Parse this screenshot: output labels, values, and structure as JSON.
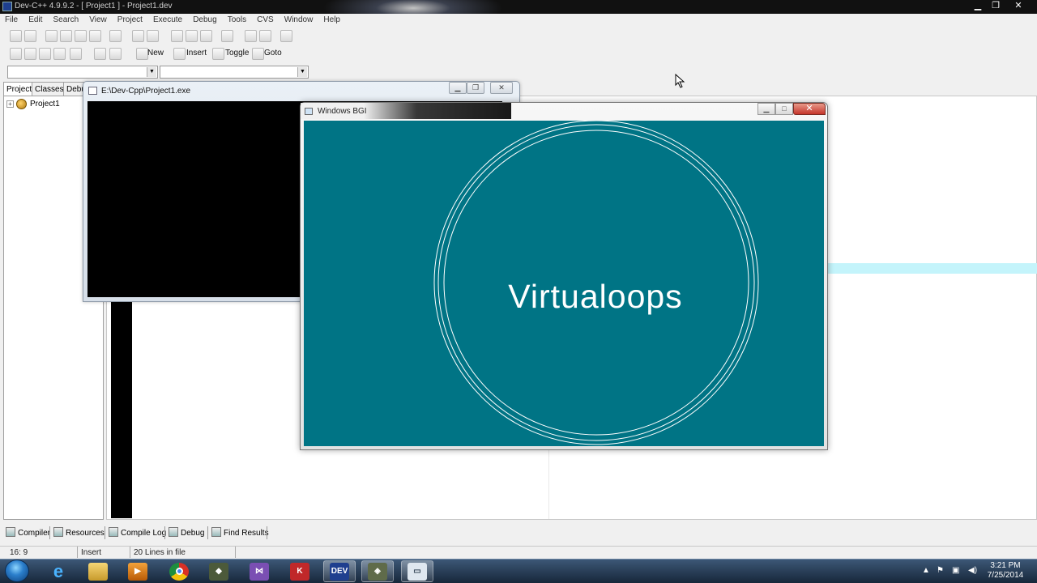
{
  "devcpp": {
    "title": "Dev-C++ 4.9.9.2  - [ Project1 ] - Project1.dev",
    "menu": [
      "File",
      "Edit",
      "Search",
      "View",
      "Project",
      "Execute",
      "Debug",
      "Tools",
      "CVS",
      "Window",
      "Help"
    ],
    "toolbar2": {
      "new": "New",
      "insert": "Insert",
      "toggle": "Toggle",
      "goto": "Goto"
    },
    "panel_tabs": [
      "Project",
      "Classes",
      "Debu"
    ],
    "tree_root": "Project1",
    "bottom_tabs": [
      "Compiler",
      "Resources",
      "Compile Log",
      "Debug",
      "Find Results"
    ],
    "status": {
      "position": "16: 9",
      "mode": "Insert",
      "lines": "20 Lines in file"
    }
  },
  "console": {
    "title": "E:\\Dev-Cpp\\Project1.exe"
  },
  "bgi": {
    "title": "Windows BGI",
    "text": "Virtualoops",
    "background": "#007485",
    "fg": "#ffffff"
  },
  "taskbar": {
    "time": "3:21 PM",
    "date": "7/25/2014",
    "apps": [
      "internet-explorer",
      "file-explorer",
      "media-player",
      "chrome",
      "app-green",
      "visual-studio",
      "app-k",
      "devcpp",
      "app-bgi",
      "app-window"
    ]
  }
}
